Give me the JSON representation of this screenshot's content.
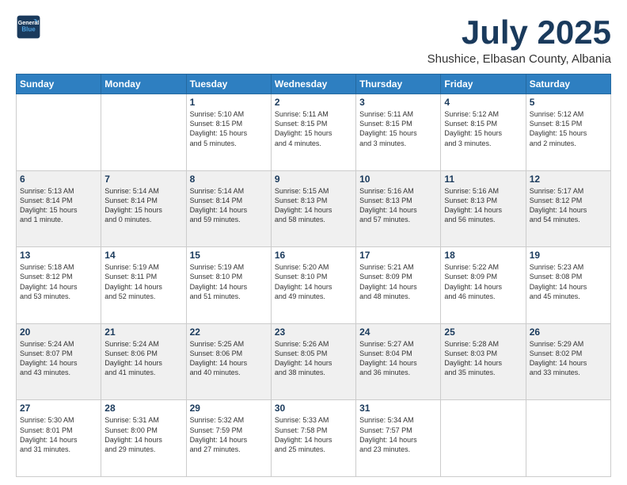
{
  "logo": {
    "line1": "General",
    "line2": "Blue"
  },
  "header": {
    "month": "July 2025",
    "location": "Shushice, Elbasan County, Albania"
  },
  "weekdays": [
    "Sunday",
    "Monday",
    "Tuesday",
    "Wednesday",
    "Thursday",
    "Friday",
    "Saturday"
  ],
  "weeks": [
    [
      {
        "day": "",
        "info": ""
      },
      {
        "day": "",
        "info": ""
      },
      {
        "day": "1",
        "info": "Sunrise: 5:10 AM\nSunset: 8:15 PM\nDaylight: 15 hours\nand 5 minutes."
      },
      {
        "day": "2",
        "info": "Sunrise: 5:11 AM\nSunset: 8:15 PM\nDaylight: 15 hours\nand 4 minutes."
      },
      {
        "day": "3",
        "info": "Sunrise: 5:11 AM\nSunset: 8:15 PM\nDaylight: 15 hours\nand 3 minutes."
      },
      {
        "day": "4",
        "info": "Sunrise: 5:12 AM\nSunset: 8:15 PM\nDaylight: 15 hours\nand 3 minutes."
      },
      {
        "day": "5",
        "info": "Sunrise: 5:12 AM\nSunset: 8:15 PM\nDaylight: 15 hours\nand 2 minutes."
      }
    ],
    [
      {
        "day": "6",
        "info": "Sunrise: 5:13 AM\nSunset: 8:14 PM\nDaylight: 15 hours\nand 1 minute."
      },
      {
        "day": "7",
        "info": "Sunrise: 5:14 AM\nSunset: 8:14 PM\nDaylight: 15 hours\nand 0 minutes."
      },
      {
        "day": "8",
        "info": "Sunrise: 5:14 AM\nSunset: 8:14 PM\nDaylight: 14 hours\nand 59 minutes."
      },
      {
        "day": "9",
        "info": "Sunrise: 5:15 AM\nSunset: 8:13 PM\nDaylight: 14 hours\nand 58 minutes."
      },
      {
        "day": "10",
        "info": "Sunrise: 5:16 AM\nSunset: 8:13 PM\nDaylight: 14 hours\nand 57 minutes."
      },
      {
        "day": "11",
        "info": "Sunrise: 5:16 AM\nSunset: 8:13 PM\nDaylight: 14 hours\nand 56 minutes."
      },
      {
        "day": "12",
        "info": "Sunrise: 5:17 AM\nSunset: 8:12 PM\nDaylight: 14 hours\nand 54 minutes."
      }
    ],
    [
      {
        "day": "13",
        "info": "Sunrise: 5:18 AM\nSunset: 8:12 PM\nDaylight: 14 hours\nand 53 minutes."
      },
      {
        "day": "14",
        "info": "Sunrise: 5:19 AM\nSunset: 8:11 PM\nDaylight: 14 hours\nand 52 minutes."
      },
      {
        "day": "15",
        "info": "Sunrise: 5:19 AM\nSunset: 8:10 PM\nDaylight: 14 hours\nand 51 minutes."
      },
      {
        "day": "16",
        "info": "Sunrise: 5:20 AM\nSunset: 8:10 PM\nDaylight: 14 hours\nand 49 minutes."
      },
      {
        "day": "17",
        "info": "Sunrise: 5:21 AM\nSunset: 8:09 PM\nDaylight: 14 hours\nand 48 minutes."
      },
      {
        "day": "18",
        "info": "Sunrise: 5:22 AM\nSunset: 8:09 PM\nDaylight: 14 hours\nand 46 minutes."
      },
      {
        "day": "19",
        "info": "Sunrise: 5:23 AM\nSunset: 8:08 PM\nDaylight: 14 hours\nand 45 minutes."
      }
    ],
    [
      {
        "day": "20",
        "info": "Sunrise: 5:24 AM\nSunset: 8:07 PM\nDaylight: 14 hours\nand 43 minutes."
      },
      {
        "day": "21",
        "info": "Sunrise: 5:24 AM\nSunset: 8:06 PM\nDaylight: 14 hours\nand 41 minutes."
      },
      {
        "day": "22",
        "info": "Sunrise: 5:25 AM\nSunset: 8:06 PM\nDaylight: 14 hours\nand 40 minutes."
      },
      {
        "day": "23",
        "info": "Sunrise: 5:26 AM\nSunset: 8:05 PM\nDaylight: 14 hours\nand 38 minutes."
      },
      {
        "day": "24",
        "info": "Sunrise: 5:27 AM\nSunset: 8:04 PM\nDaylight: 14 hours\nand 36 minutes."
      },
      {
        "day": "25",
        "info": "Sunrise: 5:28 AM\nSunset: 8:03 PM\nDaylight: 14 hours\nand 35 minutes."
      },
      {
        "day": "26",
        "info": "Sunrise: 5:29 AM\nSunset: 8:02 PM\nDaylight: 14 hours\nand 33 minutes."
      }
    ],
    [
      {
        "day": "27",
        "info": "Sunrise: 5:30 AM\nSunset: 8:01 PM\nDaylight: 14 hours\nand 31 minutes."
      },
      {
        "day": "28",
        "info": "Sunrise: 5:31 AM\nSunset: 8:00 PM\nDaylight: 14 hours\nand 29 minutes."
      },
      {
        "day": "29",
        "info": "Sunrise: 5:32 AM\nSunset: 7:59 PM\nDaylight: 14 hours\nand 27 minutes."
      },
      {
        "day": "30",
        "info": "Sunrise: 5:33 AM\nSunset: 7:58 PM\nDaylight: 14 hours\nand 25 minutes."
      },
      {
        "day": "31",
        "info": "Sunrise: 5:34 AM\nSunset: 7:57 PM\nDaylight: 14 hours\nand 23 minutes."
      },
      {
        "day": "",
        "info": ""
      },
      {
        "day": "",
        "info": ""
      }
    ]
  ]
}
